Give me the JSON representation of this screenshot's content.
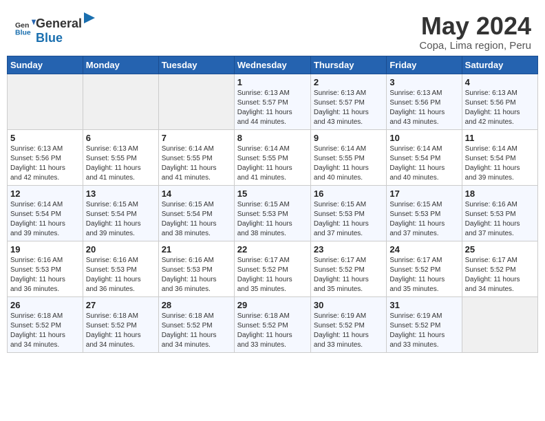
{
  "header": {
    "logo_general": "General",
    "logo_blue": "Blue",
    "month_title": "May 2024",
    "location": "Copa, Lima region, Peru"
  },
  "weekdays": [
    "Sunday",
    "Monday",
    "Tuesday",
    "Wednesday",
    "Thursday",
    "Friday",
    "Saturday"
  ],
  "weeks": [
    [
      {
        "day": "",
        "info": ""
      },
      {
        "day": "",
        "info": ""
      },
      {
        "day": "",
        "info": ""
      },
      {
        "day": "1",
        "info": "Sunrise: 6:13 AM\nSunset: 5:57 PM\nDaylight: 11 hours\nand 44 minutes."
      },
      {
        "day": "2",
        "info": "Sunrise: 6:13 AM\nSunset: 5:57 PM\nDaylight: 11 hours\nand 43 minutes."
      },
      {
        "day": "3",
        "info": "Sunrise: 6:13 AM\nSunset: 5:56 PM\nDaylight: 11 hours\nand 43 minutes."
      },
      {
        "day": "4",
        "info": "Sunrise: 6:13 AM\nSunset: 5:56 PM\nDaylight: 11 hours\nand 42 minutes."
      }
    ],
    [
      {
        "day": "5",
        "info": "Sunrise: 6:13 AM\nSunset: 5:56 PM\nDaylight: 11 hours\nand 42 minutes."
      },
      {
        "day": "6",
        "info": "Sunrise: 6:13 AM\nSunset: 5:55 PM\nDaylight: 11 hours\nand 41 minutes."
      },
      {
        "day": "7",
        "info": "Sunrise: 6:14 AM\nSunset: 5:55 PM\nDaylight: 11 hours\nand 41 minutes."
      },
      {
        "day": "8",
        "info": "Sunrise: 6:14 AM\nSunset: 5:55 PM\nDaylight: 11 hours\nand 41 minutes."
      },
      {
        "day": "9",
        "info": "Sunrise: 6:14 AM\nSunset: 5:55 PM\nDaylight: 11 hours\nand 40 minutes."
      },
      {
        "day": "10",
        "info": "Sunrise: 6:14 AM\nSunset: 5:54 PM\nDaylight: 11 hours\nand 40 minutes."
      },
      {
        "day": "11",
        "info": "Sunrise: 6:14 AM\nSunset: 5:54 PM\nDaylight: 11 hours\nand 39 minutes."
      }
    ],
    [
      {
        "day": "12",
        "info": "Sunrise: 6:14 AM\nSunset: 5:54 PM\nDaylight: 11 hours\nand 39 minutes."
      },
      {
        "day": "13",
        "info": "Sunrise: 6:15 AM\nSunset: 5:54 PM\nDaylight: 11 hours\nand 39 minutes."
      },
      {
        "day": "14",
        "info": "Sunrise: 6:15 AM\nSunset: 5:54 PM\nDaylight: 11 hours\nand 38 minutes."
      },
      {
        "day": "15",
        "info": "Sunrise: 6:15 AM\nSunset: 5:53 PM\nDaylight: 11 hours\nand 38 minutes."
      },
      {
        "day": "16",
        "info": "Sunrise: 6:15 AM\nSunset: 5:53 PM\nDaylight: 11 hours\nand 37 minutes."
      },
      {
        "day": "17",
        "info": "Sunrise: 6:15 AM\nSunset: 5:53 PM\nDaylight: 11 hours\nand 37 minutes."
      },
      {
        "day": "18",
        "info": "Sunrise: 6:16 AM\nSunset: 5:53 PM\nDaylight: 11 hours\nand 37 minutes."
      }
    ],
    [
      {
        "day": "19",
        "info": "Sunrise: 6:16 AM\nSunset: 5:53 PM\nDaylight: 11 hours\nand 36 minutes."
      },
      {
        "day": "20",
        "info": "Sunrise: 6:16 AM\nSunset: 5:53 PM\nDaylight: 11 hours\nand 36 minutes."
      },
      {
        "day": "21",
        "info": "Sunrise: 6:16 AM\nSunset: 5:53 PM\nDaylight: 11 hours\nand 36 minutes."
      },
      {
        "day": "22",
        "info": "Sunrise: 6:17 AM\nSunset: 5:52 PM\nDaylight: 11 hours\nand 35 minutes."
      },
      {
        "day": "23",
        "info": "Sunrise: 6:17 AM\nSunset: 5:52 PM\nDaylight: 11 hours\nand 35 minutes."
      },
      {
        "day": "24",
        "info": "Sunrise: 6:17 AM\nSunset: 5:52 PM\nDaylight: 11 hours\nand 35 minutes."
      },
      {
        "day": "25",
        "info": "Sunrise: 6:17 AM\nSunset: 5:52 PM\nDaylight: 11 hours\nand 34 minutes."
      }
    ],
    [
      {
        "day": "26",
        "info": "Sunrise: 6:18 AM\nSunset: 5:52 PM\nDaylight: 11 hours\nand 34 minutes."
      },
      {
        "day": "27",
        "info": "Sunrise: 6:18 AM\nSunset: 5:52 PM\nDaylight: 11 hours\nand 34 minutes."
      },
      {
        "day": "28",
        "info": "Sunrise: 6:18 AM\nSunset: 5:52 PM\nDaylight: 11 hours\nand 34 minutes."
      },
      {
        "day": "29",
        "info": "Sunrise: 6:18 AM\nSunset: 5:52 PM\nDaylight: 11 hours\nand 33 minutes."
      },
      {
        "day": "30",
        "info": "Sunrise: 6:19 AM\nSunset: 5:52 PM\nDaylight: 11 hours\nand 33 minutes."
      },
      {
        "day": "31",
        "info": "Sunrise: 6:19 AM\nSunset: 5:52 PM\nDaylight: 11 hours\nand 33 minutes."
      },
      {
        "day": "",
        "info": ""
      }
    ]
  ]
}
